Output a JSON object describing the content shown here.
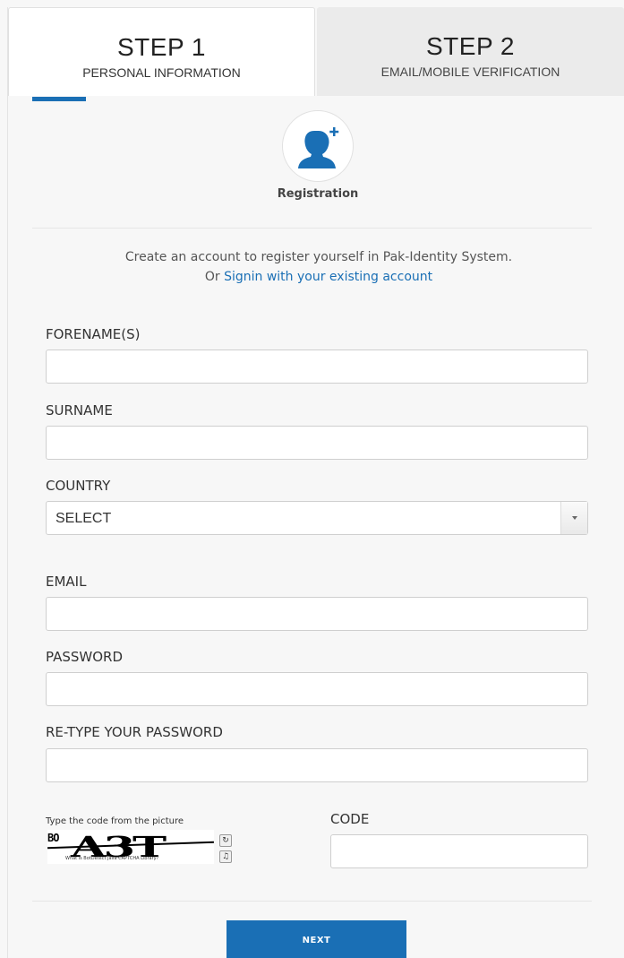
{
  "steps": [
    {
      "title": "STEP 1",
      "subtitle": "PERSONAL INFORMATION",
      "active": true
    },
    {
      "title": "STEP 2",
      "subtitle": "EMAIL/MOBILE VERIFICATION",
      "active": false
    }
  ],
  "header": {
    "icon": "add-user-icon",
    "title": "Registration"
  },
  "intro": {
    "line1": "Create an account to register yourself in Pak-Identity System.",
    "line2_prefix": "Or",
    "signin_link": "Signin with your existing account"
  },
  "form": {
    "forename": {
      "label": "FORENAME(S)",
      "value": ""
    },
    "surname": {
      "label": "SURNAME",
      "value": ""
    },
    "country": {
      "label": "COUNTRY",
      "selected": "SELECT"
    },
    "email": {
      "label": "EMAIL",
      "value": ""
    },
    "password": {
      "label": "PASSWORD",
      "value": ""
    },
    "retype_password": {
      "label": "RE-TYPE YOUR PASSWORD",
      "value": ""
    }
  },
  "captcha": {
    "instruction": "Type the code from the picture",
    "image_text_large": "A3T",
    "image_text_small": "BO",
    "image_caption": "What is BotDetect Java CAPTCHA Library?",
    "reload_icon": "reload-icon",
    "sound_icon": "speaker-icon",
    "code_label": "CODE",
    "code_value": ""
  },
  "actions": {
    "next_label": "NEXT"
  },
  "colors": {
    "accent": "#1a6fb5",
    "panel_bg": "#f7f7f7",
    "inactive_tab": "#ebebeb"
  }
}
